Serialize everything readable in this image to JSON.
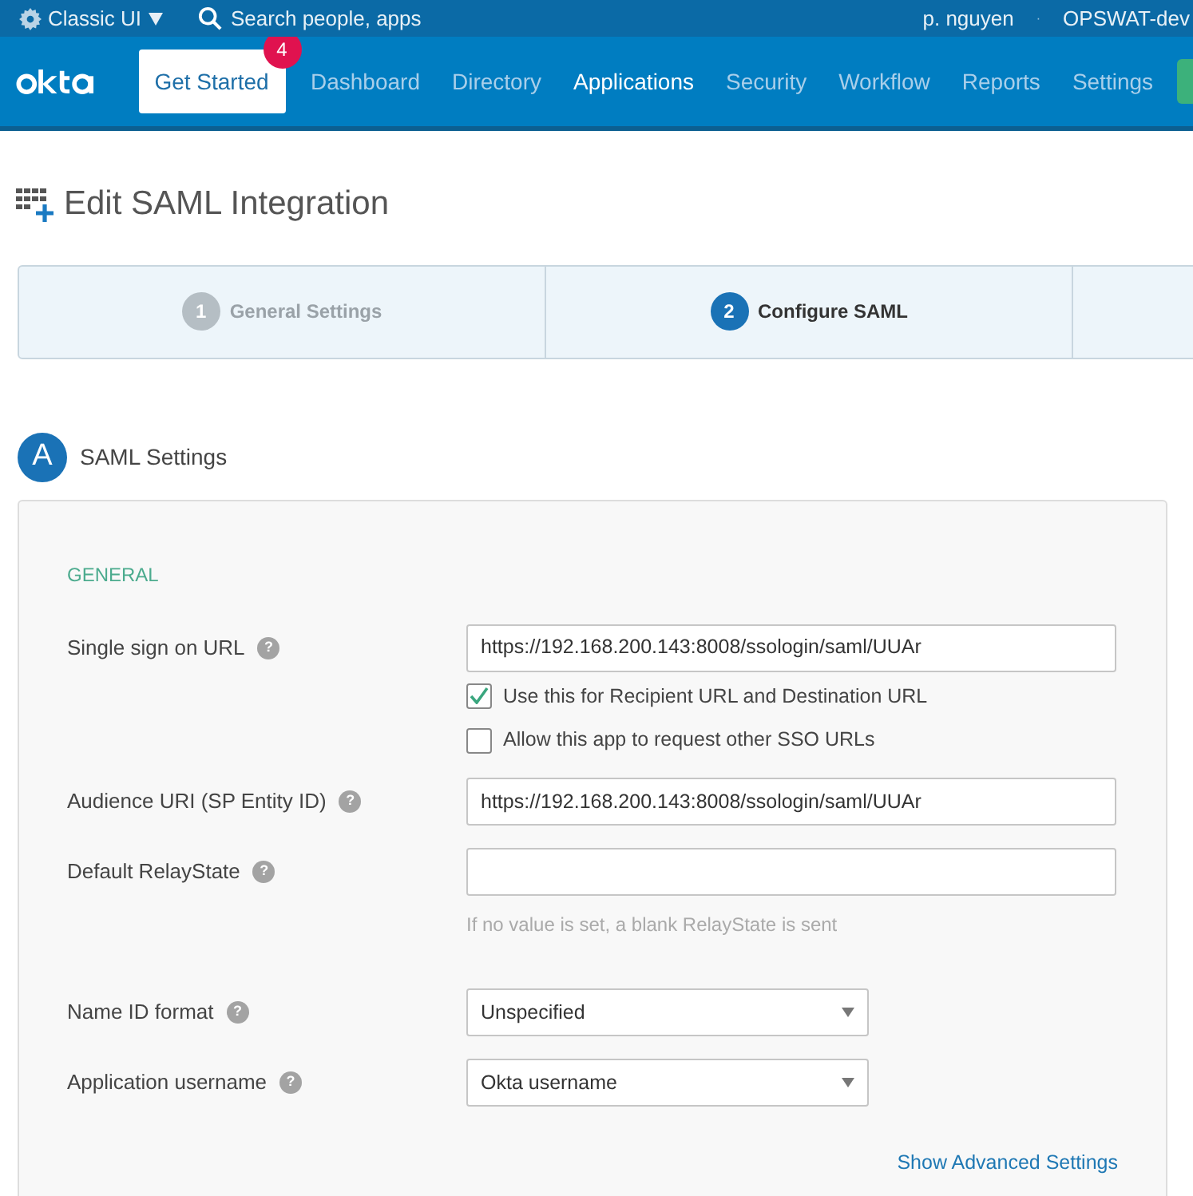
{
  "top_bar": {
    "ui_switch": "Classic UI",
    "separator": "·",
    "search_placeholder": "Search people, apps",
    "user": "p. nguyen",
    "org": "OPSWAT-dev"
  },
  "nav": {
    "get_started": "Get Started",
    "badge": "4",
    "items": [
      {
        "label": "Dashboard",
        "selected": false
      },
      {
        "label": "Directory",
        "selected": false
      },
      {
        "label": "Applications",
        "selected": true
      },
      {
        "label": "Security",
        "selected": false
      },
      {
        "label": "Workflow",
        "selected": false
      },
      {
        "label": "Reports",
        "selected": false
      },
      {
        "label": "Settings",
        "selected": false
      }
    ]
  },
  "page_title": "Edit SAML Integration",
  "steps": [
    {
      "number": "1",
      "label": "General Settings",
      "selected": false
    },
    {
      "number": "2",
      "label": "Configure SAML",
      "selected": true
    }
  ],
  "section": {
    "letter": "A",
    "title": "SAML Settings"
  },
  "panel": {
    "heading": "GENERAL",
    "help": "?",
    "rows": [
      {
        "kind": "text",
        "label": "Single sign on URL",
        "value": "https://192.168.200.143:8008/ssologin/saml/UUAr",
        "checkboxes": [
          {
            "label": "Use this for Recipient URL and Destination URL",
            "checked": true
          },
          {
            "label": "Allow this app to request other SSO URLs",
            "checked": false
          }
        ]
      },
      {
        "kind": "text",
        "label": "Audience URI (SP Entity ID)",
        "value": "https://192.168.200.143:8008/ssologin/saml/UUAr"
      },
      {
        "kind": "text",
        "label": "Default RelayState",
        "hint": "If no value is set, a blank RelayState is sent"
      },
      {
        "kind": "select",
        "label": "Name ID format",
        "value": "Unspecified"
      },
      {
        "kind": "select",
        "label": "Application username",
        "value": "Okta username"
      }
    ],
    "link": "Show Advanced Settings"
  }
}
